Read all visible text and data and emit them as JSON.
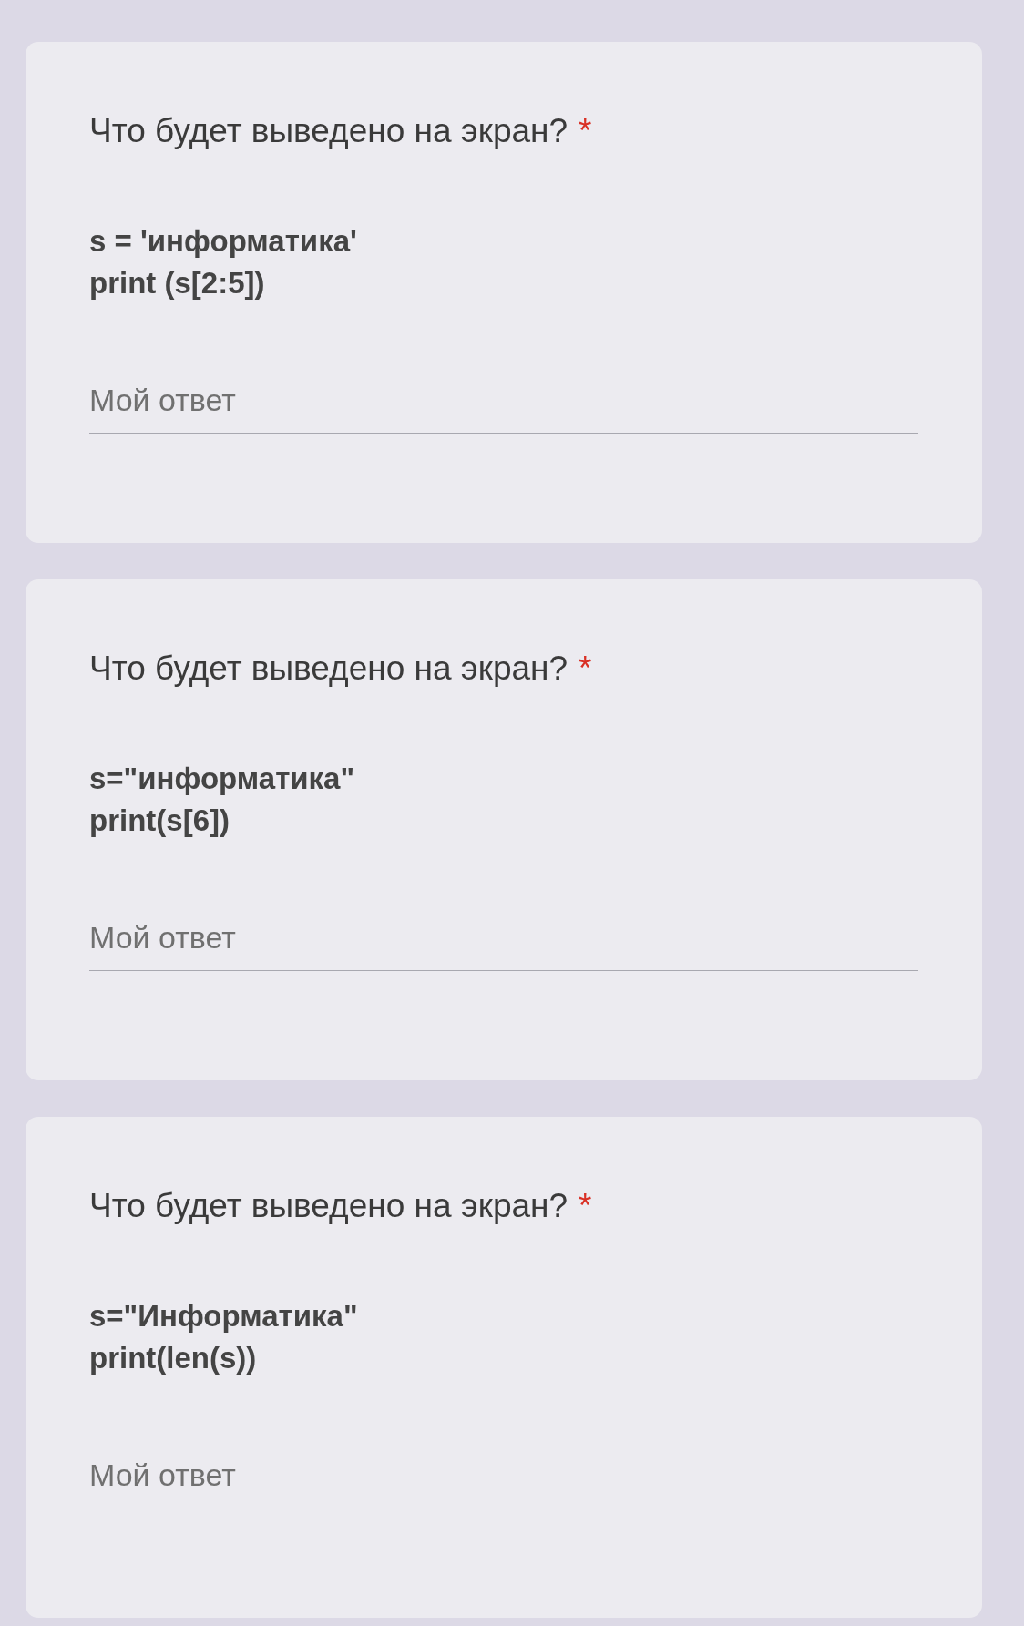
{
  "questions": [
    {
      "title": "Что будет выведено на экран?",
      "required_mark": "*",
      "code": [
        "s = 'информатика'",
        "print (s[2:5])"
      ],
      "answer": {
        "placeholder": "Мой ответ"
      }
    },
    {
      "title": "Что будет выведено на экран?",
      "required_mark": "*",
      "code": [
        "s=\"информатика\"",
        "print(s[6])"
      ],
      "answer": {
        "placeholder": "Мой ответ"
      }
    },
    {
      "title": "Что будет выведено на экран?",
      "required_mark": "*",
      "code": [
        "s=\"Информатика\"",
        "print(len(s))"
      ],
      "answer": {
        "placeholder": "Мой ответ"
      }
    }
  ]
}
